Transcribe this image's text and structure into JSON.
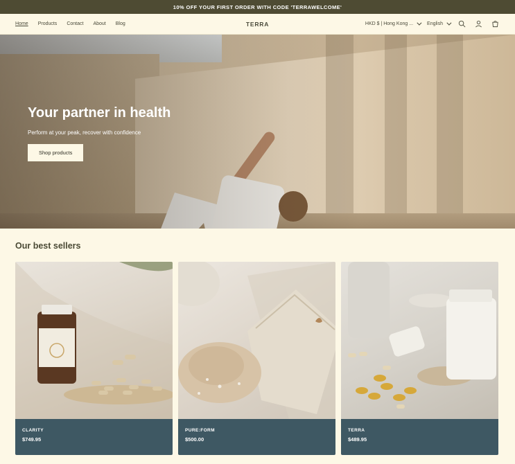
{
  "announcement": "10% OFF YOUR FIRST ORDER WITH CODE 'TERRAWELCOME'",
  "header": {
    "nav": [
      "Home",
      "Products",
      "Contact",
      "About",
      "Blog"
    ],
    "logo": "TERRA",
    "currency": "HKD $ | Hong Kong ...",
    "language": "English"
  },
  "hero": {
    "title": "Your partner in health",
    "subtitle": "Perform at your peak, recover with confidence",
    "button": "Shop products"
  },
  "bestsellers": {
    "title": "Our best sellers",
    "products": [
      {
        "name": "CLARITY",
        "price": "$749.95"
      },
      {
        "name": "PURE:FORM",
        "price": "$500.00"
      },
      {
        "name": "TERRA",
        "price": "$489.95"
      }
    ]
  },
  "colors": {
    "announcement_bg": "#4e4b33",
    "page_bg": "#fdf8e6",
    "card_footer": "#3e5863"
  }
}
